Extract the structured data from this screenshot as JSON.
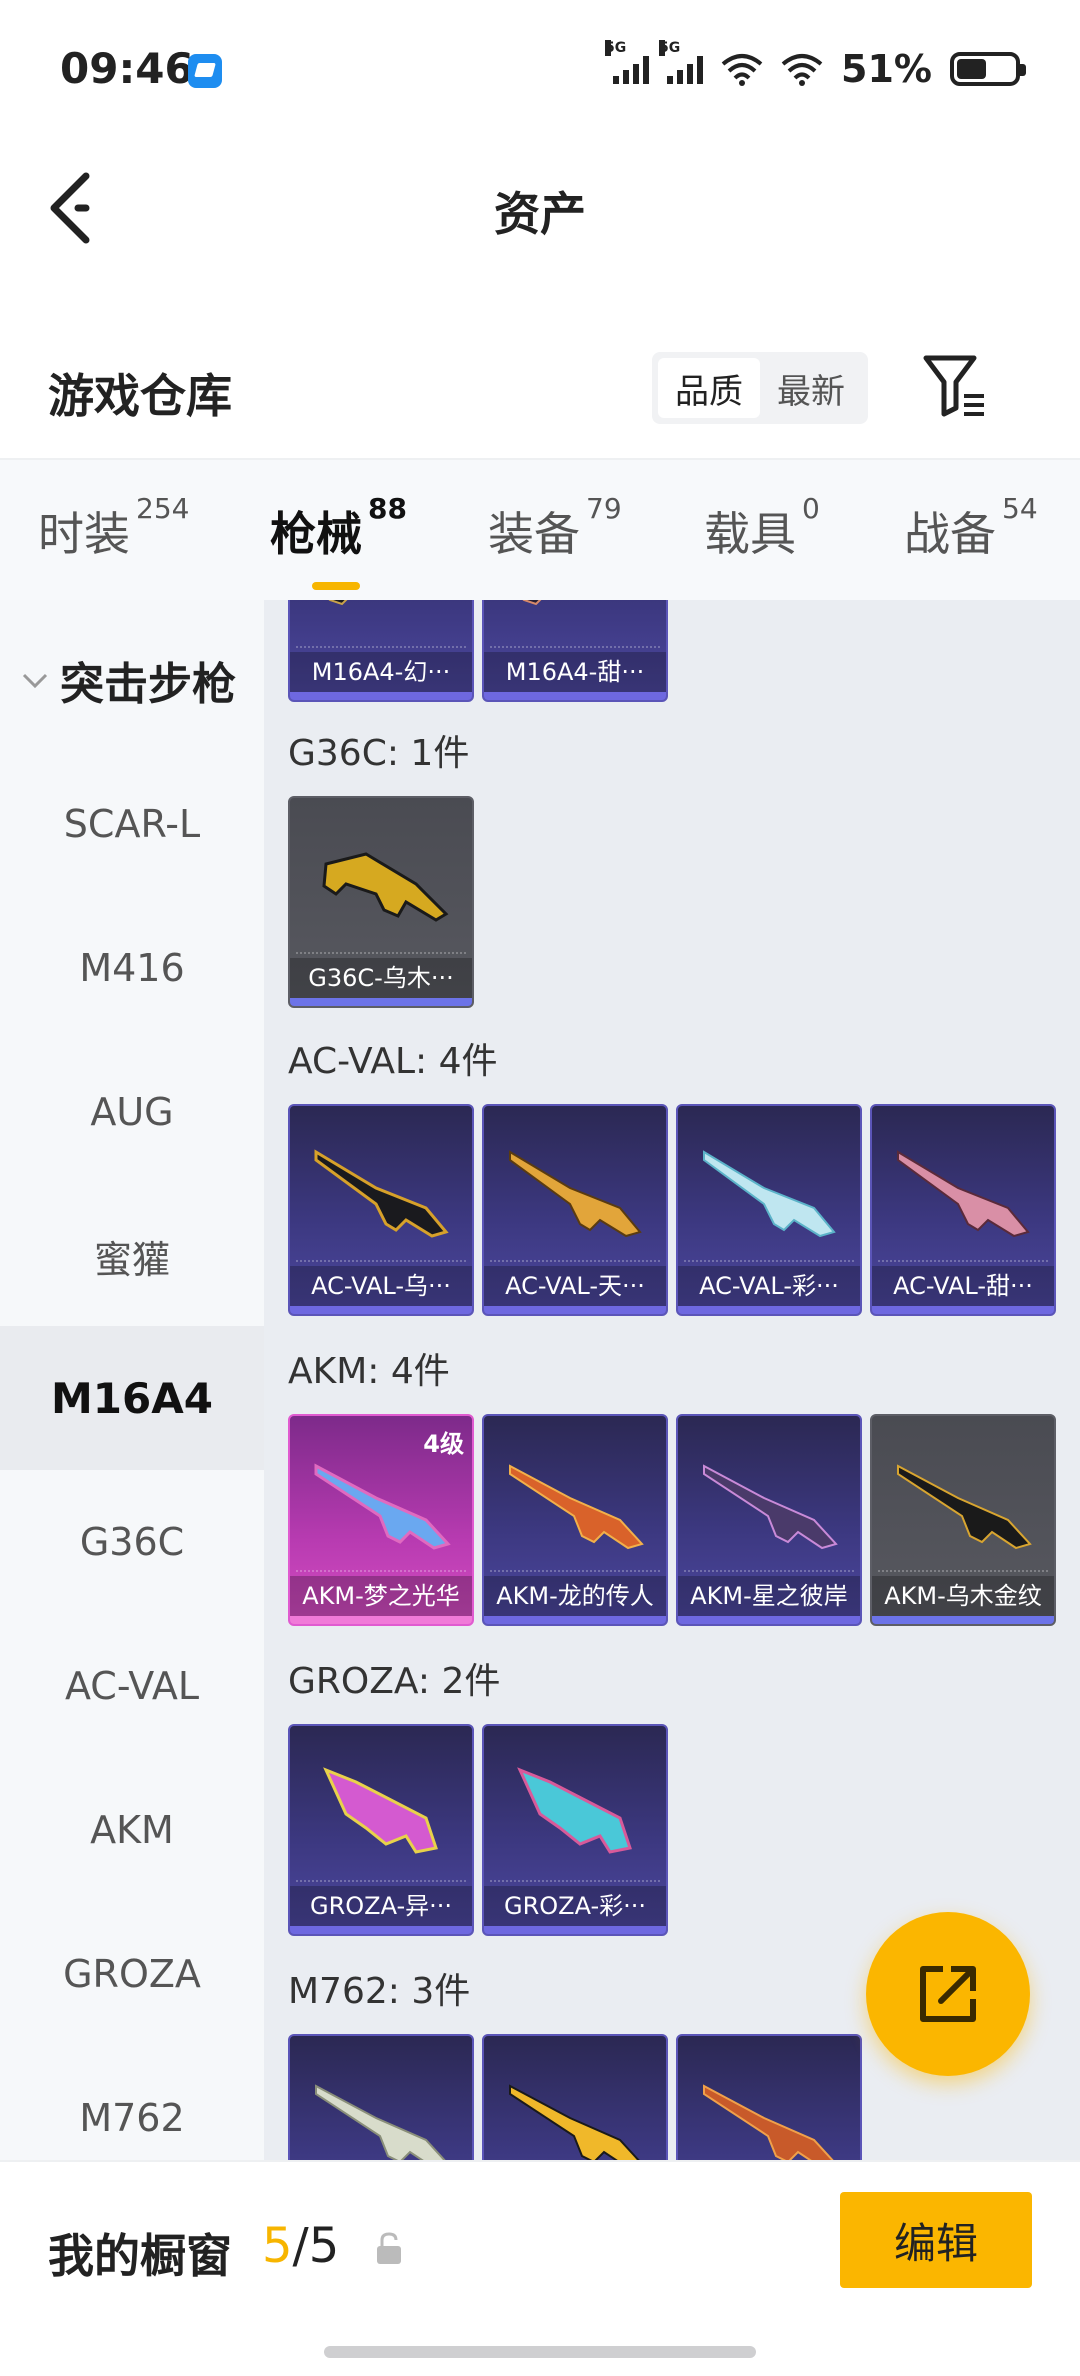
{
  "status": {
    "time": "09:46",
    "battery": "51%",
    "signal_tag": "5G"
  },
  "header": {
    "title": "资产"
  },
  "warehouse": {
    "title": "游戏仓库",
    "sort_options": [
      "品质",
      "最新"
    ]
  },
  "category_tabs": [
    {
      "label": "时装",
      "count": "254"
    },
    {
      "label": "枪械",
      "count": "88"
    },
    {
      "label": "装备",
      "count": "79"
    },
    {
      "label": "载具",
      "count": "0"
    },
    {
      "label": "战备",
      "count": "54"
    }
  ],
  "sidebar": {
    "group": "突击步枪",
    "items": [
      "SCAR-L",
      "M416",
      "AUG",
      "蜜獾",
      "M16A4",
      "G36C",
      "AC-VAL",
      "AKM",
      "GROZA",
      "M762"
    ],
    "active": "M16A4"
  },
  "content": {
    "m16_cards": [
      "M16A4-幻···",
      "M16A4-甜···"
    ],
    "groups": [
      {
        "label": "G36C: 1件",
        "cards": [
          "G36C-乌木···"
        ]
      },
      {
        "label": "AC-VAL: 4件",
        "cards": [
          "AC-VAL-乌···",
          "AC-VAL-天···",
          "AC-VAL-彩···",
          "AC-VAL-甜···"
        ]
      },
      {
        "label": "AKM: 4件",
        "cards": [
          "AKM-梦之光华",
          "AKM-龙的传人",
          "AKM-星之彼岸",
          "AKM-乌木金纹"
        ],
        "level_badge": "4级"
      },
      {
        "label": "GROZA: 2件",
        "cards": [
          "GROZA-异···",
          "GROZA-彩···"
        ]
      },
      {
        "label": "M762: 3件",
        "cards": [
          "",
          "",
          ""
        ]
      }
    ]
  },
  "bottom": {
    "showcase_title": "我的橱窗",
    "current": "5",
    "separator": "/",
    "total": "5",
    "edit_label": "编辑"
  },
  "colors": {
    "accent": "#fbb600",
    "card_purple": "#3c3880",
    "card_gray": "#585960",
    "card_pink": "#b83bb1"
  }
}
